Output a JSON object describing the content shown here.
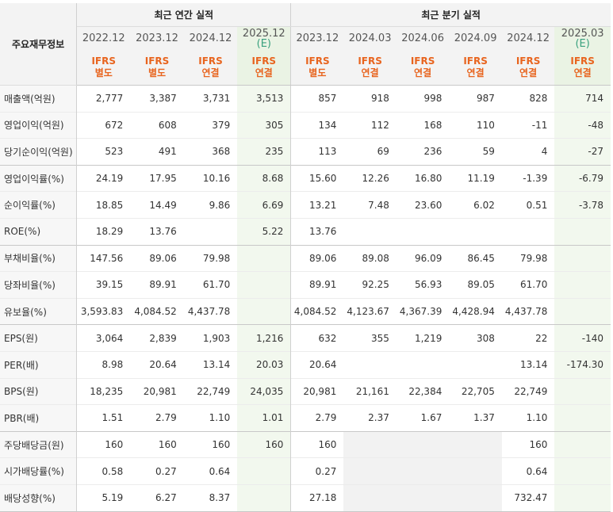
{
  "header": {
    "label": "주요재무정보",
    "annual_title": "최근 연간 실적",
    "quarter_title": "최근 분기 실적",
    "annual_periods": [
      "2022.12",
      "2023.12",
      "2024.12",
      "2025.12"
    ],
    "quarter_periods": [
      "2023.12",
      "2024.03",
      "2024.06",
      "2024.09",
      "2024.12",
      "2025.03"
    ],
    "estimate_mark": "(E)",
    "annual_std_top": [
      "IFRS",
      "IFRS",
      "IFRS",
      "IFRS"
    ],
    "annual_std_bottom": [
      "별도",
      "별도",
      "연결",
      "연결"
    ],
    "quarter_std_top": [
      "IFRS",
      "IFRS",
      "IFRS",
      "IFRS",
      "IFRS",
      "IFRS"
    ],
    "quarter_std_bottom": [
      "별도",
      "연결",
      "연결",
      "연결",
      "연결",
      "연결"
    ]
  },
  "rows": [
    {
      "label": "매출액(억원)",
      "values": [
        "2,777",
        "3,387",
        "3,731",
        "3,513",
        "857",
        "918",
        "998",
        "987",
        "828",
        "714"
      ]
    },
    {
      "label": "영업이익(억원)",
      "values": [
        "672",
        "608",
        "379",
        "305",
        "134",
        "112",
        "168",
        "110",
        "-11",
        "-48"
      ]
    },
    {
      "label": "당기순이익(억원)",
      "values": [
        "523",
        "491",
        "368",
        "235",
        "113",
        "69",
        "236",
        "59",
        "4",
        "-27"
      ]
    },
    {
      "label": "영업이익률(%)",
      "values": [
        "24.19",
        "17.95",
        "10.16",
        "8.68",
        "15.60",
        "12.26",
        "16.80",
        "11.19",
        "-1.39",
        "-6.79"
      ]
    },
    {
      "label": "순이익률(%)",
      "values": [
        "18.85",
        "14.49",
        "9.86",
        "6.69",
        "13.21",
        "7.48",
        "23.60",
        "6.02",
        "0.51",
        "-3.78"
      ]
    },
    {
      "label": "ROE(%)",
      "values": [
        "18.29",
        "13.76",
        "",
        "5.22",
        "13.76",
        "",
        "",
        "",
        "",
        ""
      ]
    },
    {
      "label": "부채비율(%)",
      "values": [
        "147.56",
        "89.06",
        "79.98",
        "",
        "89.06",
        "89.08",
        "96.09",
        "86.45",
        "79.98",
        ""
      ]
    },
    {
      "label": "당좌비율(%)",
      "values": [
        "39.15",
        "89.91",
        "61.70",
        "",
        "89.91",
        "92.25",
        "56.93",
        "89.05",
        "61.70",
        ""
      ]
    },
    {
      "label": "유보율(%)",
      "values": [
        "3,593.83",
        "4,084.52",
        "4,437.78",
        "",
        "4,084.52",
        "4,123.67",
        "4,367.39",
        "4,428.94",
        "4,437.78",
        ""
      ]
    },
    {
      "label": "EPS(원)",
      "values": [
        "3,064",
        "2,839",
        "1,903",
        "1,216",
        "632",
        "355",
        "1,219",
        "308",
        "22",
        "-140"
      ]
    },
    {
      "label": "PER(배)",
      "values": [
        "8.98",
        "20.64",
        "13.14",
        "20.03",
        "20.64",
        "",
        "",
        "",
        "13.14",
        "-174.30"
      ]
    },
    {
      "label": "BPS(원)",
      "values": [
        "18,235",
        "20,981",
        "22,749",
        "24,035",
        "20,981",
        "21,161",
        "22,384",
        "22,705",
        "22,749",
        ""
      ]
    },
    {
      "label": "PBR(배)",
      "values": [
        "1.51",
        "2.79",
        "1.10",
        "1.01",
        "2.79",
        "2.37",
        "1.67",
        "1.37",
        "1.10",
        ""
      ]
    },
    {
      "label": "주당배당금(원)",
      "values": [
        "160",
        "160",
        "160",
        "160",
        "160",
        "",
        "",
        "",
        "160",
        ""
      ]
    },
    {
      "label": "시가배당률(%)",
      "values": [
        "0.58",
        "0.27",
        "0.64",
        "",
        "0.27",
        "",
        "",
        "",
        "0.64",
        ""
      ]
    },
    {
      "label": "배당성향(%)",
      "values": [
        "5.19",
        "6.27",
        "8.37",
        "",
        "27.18",
        "",
        "",
        "",
        "732.47",
        ""
      ]
    }
  ],
  "colors": {
    "ifrs": "#e8641e",
    "estimate": "#3aa17e",
    "negative": "#e83a3a"
  }
}
